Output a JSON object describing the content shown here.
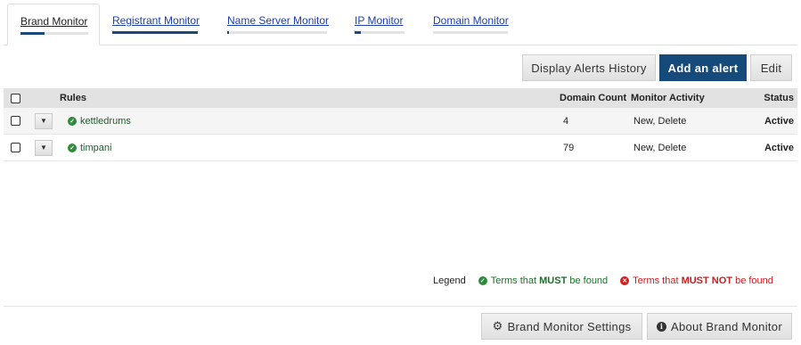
{
  "tabs": [
    {
      "label": "Brand Monitor",
      "active": true,
      "progress": 0.35
    },
    {
      "label": "Registrant Monitor",
      "active": false,
      "progress": 1.0
    },
    {
      "label": "Name Server Monitor",
      "active": false,
      "progress": 0.02
    },
    {
      "label": "IP Monitor",
      "active": false,
      "progress": 0.12
    },
    {
      "label": "Domain Monitor",
      "active": false,
      "progress": 0.0
    }
  ],
  "toolbar": {
    "history_label": "Display Alerts History",
    "add_label": "Add an alert",
    "edit_label": "Edit"
  },
  "table": {
    "headers": {
      "rules": "Rules",
      "domain_count": "Domain Count",
      "monitor_activity": "Monitor Activity",
      "status": "Status"
    },
    "rows": [
      {
        "rule": "kettledrums",
        "domain_count": "4",
        "monitor_activity": "New, Delete",
        "status": "Active"
      },
      {
        "rule": "timpani",
        "domain_count": "79",
        "monitor_activity": "New, Delete",
        "status": "Active"
      }
    ]
  },
  "legend": {
    "label": "Legend",
    "must_prefix": "Terms that ",
    "must_emph": "MUST",
    "must_suffix": " be found",
    "mustnot_prefix": "Terms that ",
    "mustnot_emph": "MUST NOT",
    "mustnot_suffix": " be found"
  },
  "footer": {
    "settings_label": "Brand Monitor Settings",
    "about_label": "About Brand Monitor"
  },
  "colors": {
    "primary": "#164a7a",
    "link": "#1a3fb0",
    "must": "#2e8b3a",
    "mustnot": "#d02020"
  },
  "icons": [
    "checkbox",
    "caret-down-icon",
    "check-circle-icon",
    "x-circle-icon",
    "gear-icon",
    "info-icon"
  ]
}
